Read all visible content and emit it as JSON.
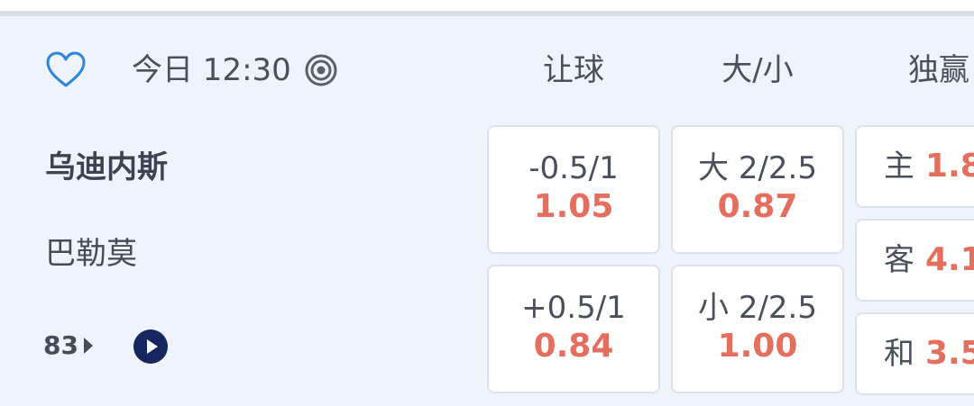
{
  "match": {
    "time": "今日 12:30",
    "home_team": "乌迪内斯",
    "away_team": "巴勒莫",
    "more_markets_count": "83"
  },
  "columns": {
    "handicap": "让球",
    "over_under": "大/小",
    "moneyline": "独赢"
  },
  "handicap": [
    {
      "line": "-0.5/1",
      "price": "1.05"
    },
    {
      "line": "+0.5/1",
      "price": "0.84"
    }
  ],
  "over_under": [
    {
      "line": "大 2/2.5",
      "price": "0.87"
    },
    {
      "line": "小 2/2.5",
      "price": "1.00"
    }
  ],
  "moneyline": [
    {
      "label": "主",
      "price": "1.8"
    },
    {
      "label": "客",
      "price": "4.1"
    },
    {
      "label": "和",
      "price": "3.5"
    }
  ],
  "colors": {
    "background": "#eff3fc",
    "price": "#e56f5f",
    "heart": "#2e86d8",
    "play": "#15275f"
  },
  "icons": [
    "heart-outline-icon",
    "live-target-icon",
    "play-icon",
    "arrow-right-icon"
  ]
}
